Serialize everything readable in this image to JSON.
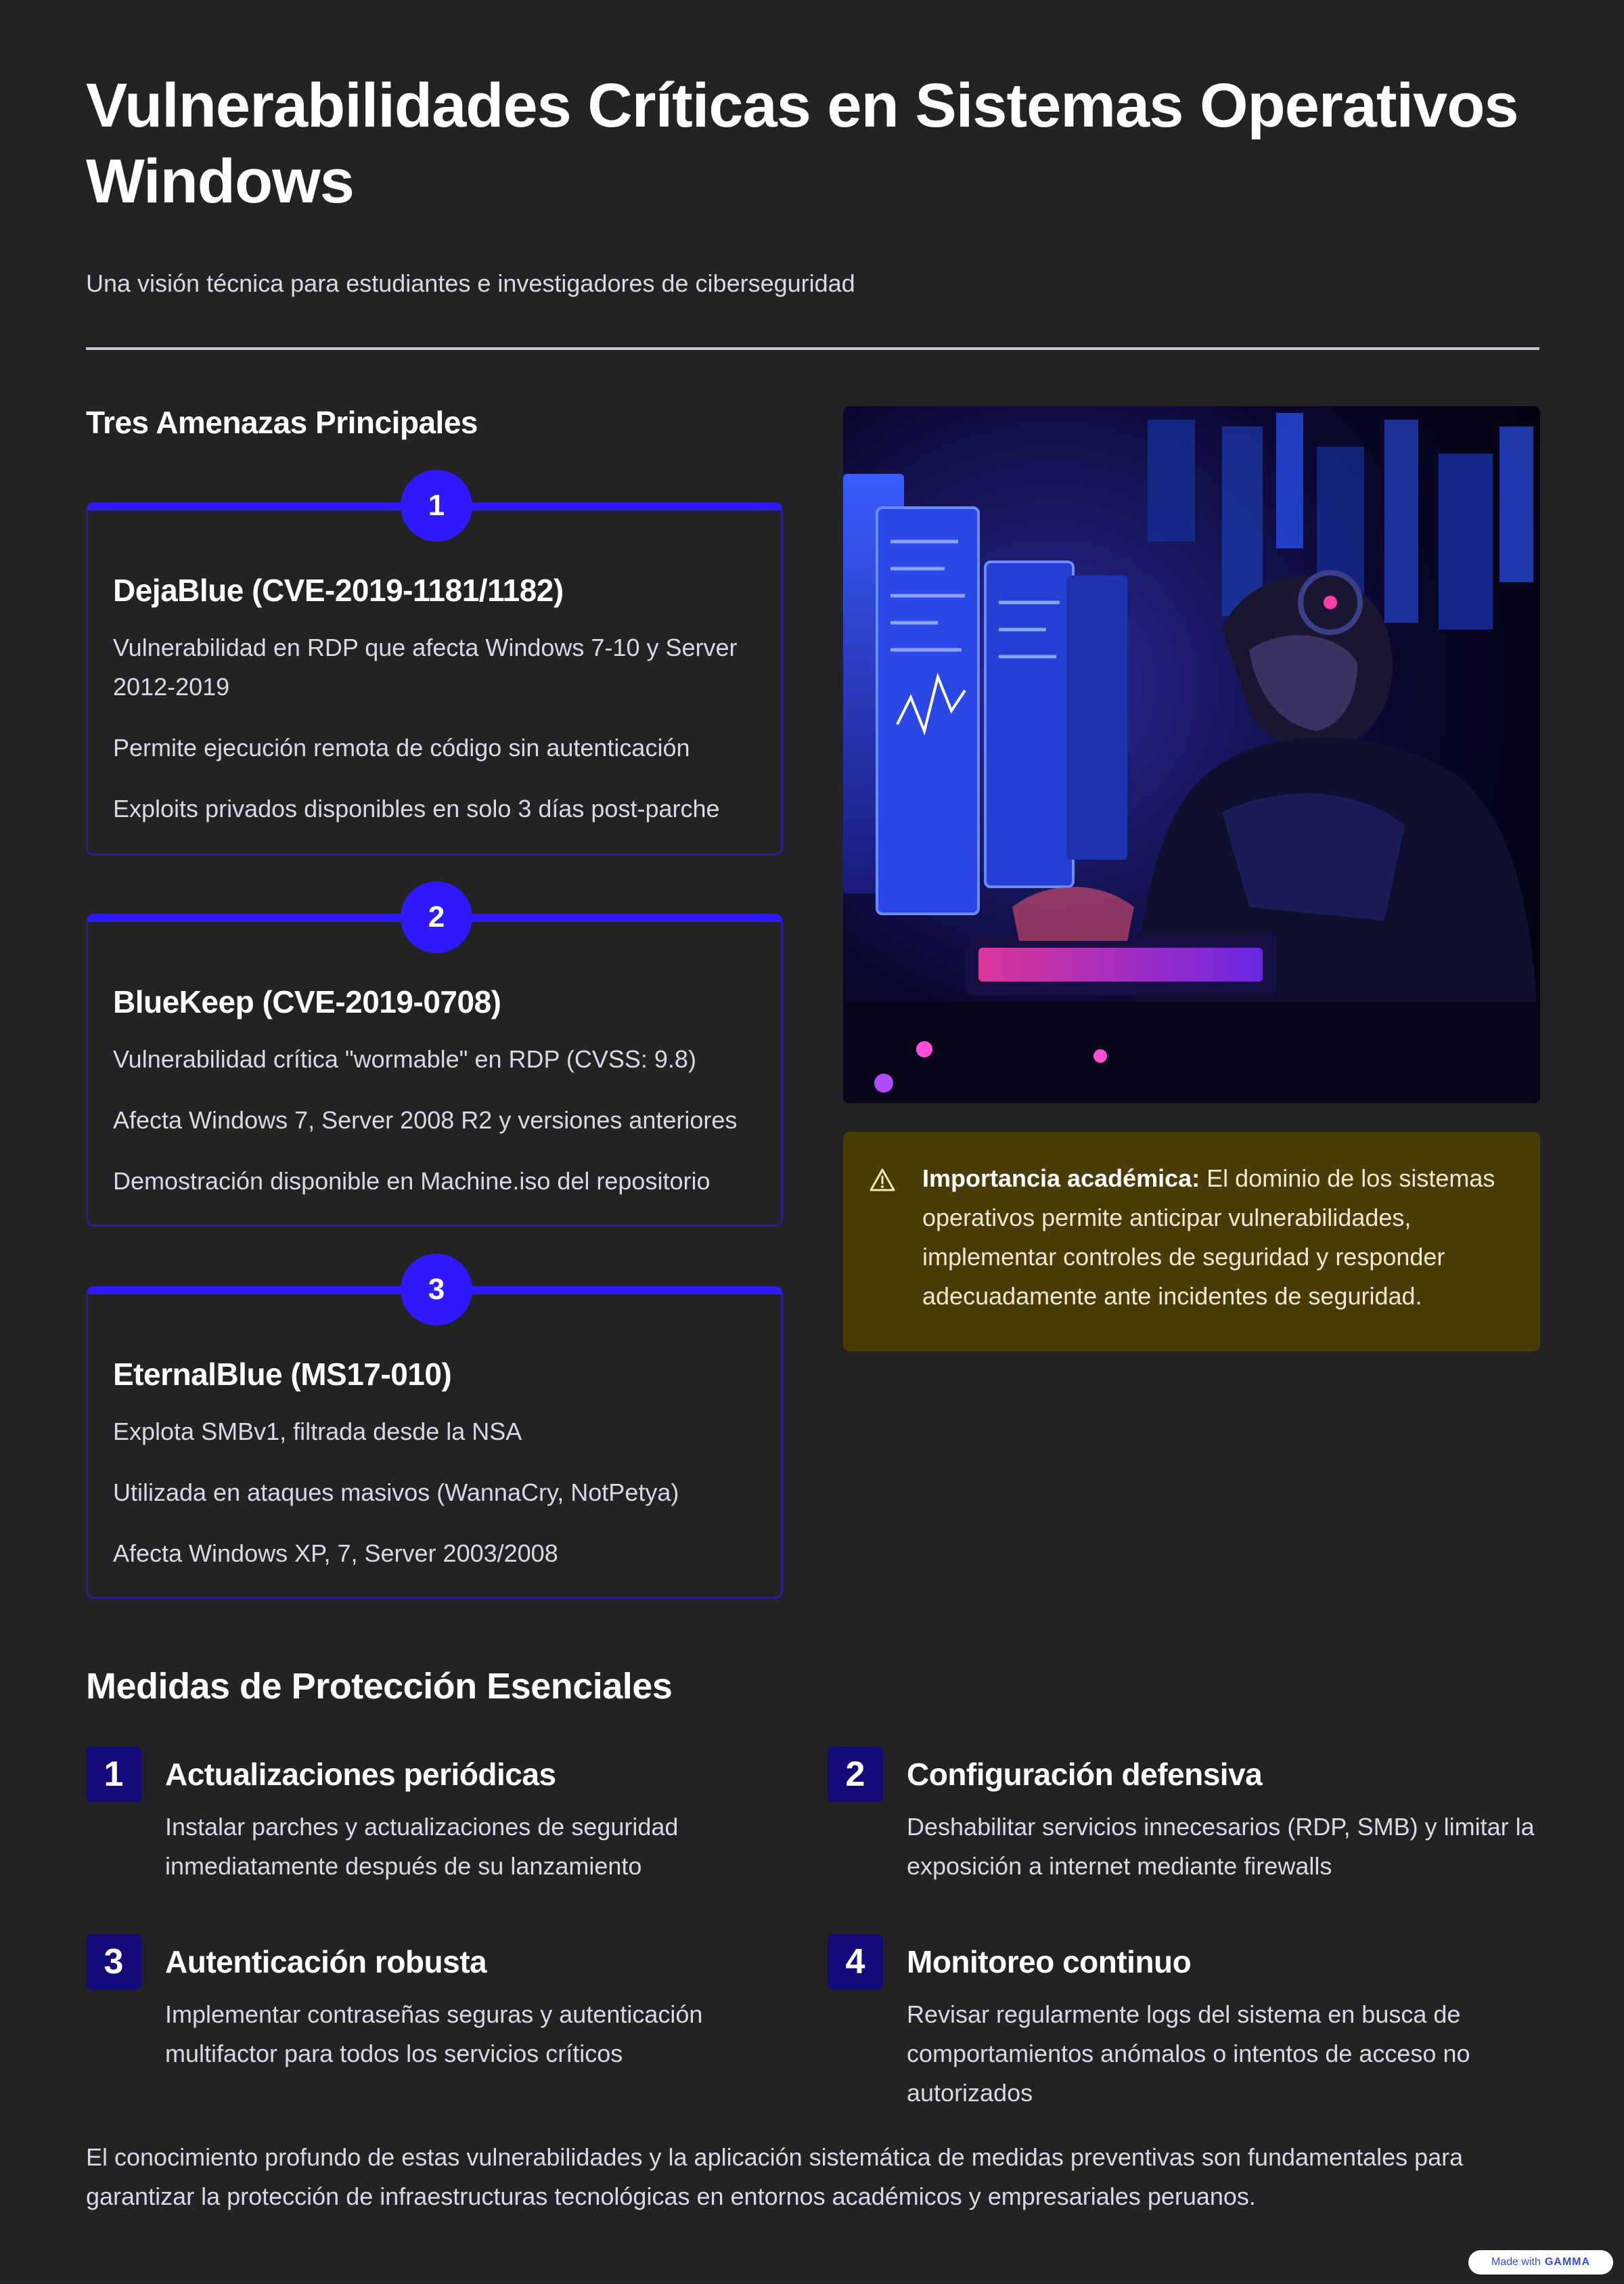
{
  "header": {
    "title": "Vulnerabilidades Críticas en Sistemas Operativos Windows",
    "subtitle": "Una visión técnica para estudiantes e investigadores de ciberseguridad"
  },
  "threats": {
    "heading": "Tres Amenazas Principales",
    "items": [
      {
        "number": "1",
        "title": "DejaBlue (CVE-2019-1181/1182)",
        "lines": [
          "Vulnerabilidad en RDP que afecta Windows 7-10 y Server 2012-2019",
          "Permite ejecución remota de código sin autenticación",
          "Exploits privados disponibles en solo 3 días post-parche"
        ]
      },
      {
        "number": "2",
        "title": "BlueKeep (CVE-2019-0708)",
        "lines": [
          "Vulnerabilidad crítica \"wormable\" en RDP (CVSS: 9.8)",
          "Afecta Windows 7, Server 2008 R2 y versiones anteriores",
          "Demostración disponible en Machine.iso del repositorio"
        ]
      },
      {
        "number": "3",
        "title": "EternalBlue (MS17-010)",
        "lines": [
          "Explota SMBv1, filtrada desde la NSA",
          "Utilizada en ataques masivos (WannaCry, NotPetya)",
          "Afecta Windows XP, 7, Server 2003/2008"
        ]
      }
    ]
  },
  "hero_image": {
    "icon": "hacker-at-monitors-illustration"
  },
  "callout": {
    "icon": "warning-icon",
    "label": "Importancia académica:",
    "text": " El dominio de los sistemas operativos permite anticipar vulnerabilidades, implementar controles de seguridad y responder adecuadamente ante incidentes de seguridad."
  },
  "measures": {
    "heading": "Medidas de Protección Esenciales",
    "items": [
      {
        "number": "1",
        "title": "Actualizaciones periódicas",
        "desc": "Instalar parches y actualizaciones de seguridad inmediatamente después de su lanzamiento"
      },
      {
        "number": "2",
        "title": "Configuración defensiva",
        "desc": "Deshabilitar servicios innecesarios (RDP, SMB) y limitar la exposición a internet mediante firewalls"
      },
      {
        "number": "3",
        "title": "Autenticación robusta",
        "desc": "Implementar contraseñas seguras y autenticación multifactor para todos los servicios críticos"
      },
      {
        "number": "4",
        "title": "Monitoreo continuo",
        "desc": "Revisar regularmente logs del sistema en busca de comportamientos anómalos o intentos de acceso no autorizados"
      }
    ]
  },
  "conclusion": "El conocimiento profundo de estas vulnerabilidades y la aplicación sistemática de medidas preventivas son fundamentales para garantizar la protección de infraestructuras tecnológicas en entornos académicos y empresariales peruanos.",
  "badge": {
    "prefix": "Made with",
    "brand": "GAMMA"
  },
  "colors": {
    "background": "#232224",
    "accent": "#2f1aff",
    "measure_badge": "#150a7a",
    "callout_bg": "#4a3c06"
  }
}
